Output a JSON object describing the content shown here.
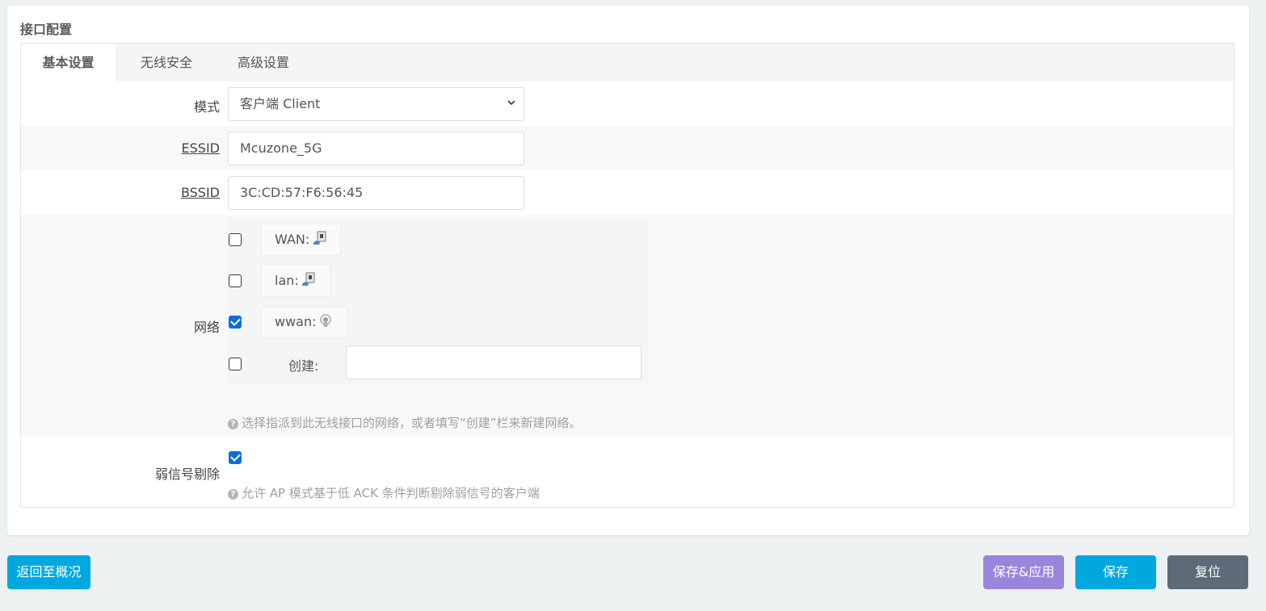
{
  "panel": {
    "title": "接口配置"
  },
  "tabs": [
    {
      "label": "基本设置",
      "active": true
    },
    {
      "label": "无线安全",
      "active": false
    },
    {
      "label": "高级设置",
      "active": false
    }
  ],
  "form": {
    "mode": {
      "label": "模式",
      "value": "客户端 Client"
    },
    "essid": {
      "label": "ESSID",
      "value": "Mcuzone_5G"
    },
    "bssid": {
      "label": "BSSID",
      "value": "3C:CD:57:F6:56:45"
    },
    "network": {
      "label": "网络",
      "options": [
        {
          "name": "WAN:",
          "checked": false,
          "icon": "ethernet-icon"
        },
        {
          "name": "lan:",
          "checked": false,
          "icon": "ethernet-icon"
        },
        {
          "name": "wwan:",
          "checked": true,
          "icon": "wifi-icon"
        }
      ],
      "create_label": "创建:",
      "create_checked": false,
      "create_value": "",
      "hint": "选择指派到此无线接口的网络，或者填写“创建”栏来新建网络。"
    },
    "disassoc_low_ack": {
      "label": "弱信号剔除",
      "checked": true,
      "hint": "允许 AP 模式基于低 ACK 条件判断剔除弱信号的客户端"
    }
  },
  "buttons": {
    "back": "返回至概况",
    "save_apply": "保存&应用",
    "save": "保存",
    "reset": "复位"
  },
  "colors": {
    "back": "#00a8e0",
    "save_apply": "#9a85dc",
    "save": "#00a8e0",
    "reset": "#5d6b78",
    "checkbox_checked": "#0a6fd8"
  }
}
